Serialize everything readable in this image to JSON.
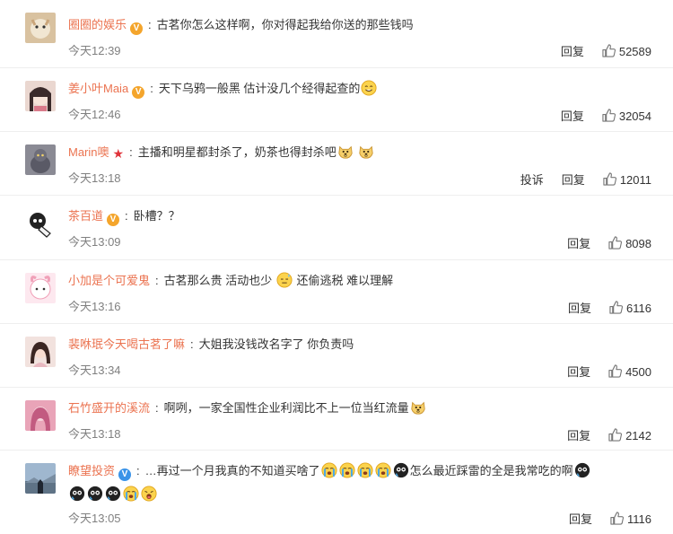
{
  "comments": [
    {
      "user": "圈圈的娱乐",
      "badge": "gold",
      "text": "古茗你怎么这样啊，你对得起我给你送的那些钱吗",
      "time": "今天12:39",
      "reply": "回复",
      "likes": "52589",
      "emojis": []
    },
    {
      "user": "姜小叶Maia",
      "badge": "gold",
      "text": "天下乌鸦一般黑 估计没几个经得起查的",
      "time": "今天12:46",
      "reply": "回复",
      "likes": "32054",
      "emojis": [
        "smile"
      ]
    },
    {
      "user": "Marin噢",
      "badge": "star",
      "text": "主播和明星都封杀了，奶茶也得封杀吧",
      "time": "今天13:18",
      "report": "投诉",
      "reply": "回复",
      "likes": "12011",
      "emojis": [
        "doge",
        "doge"
      ]
    },
    {
      "user": "茶百道",
      "badge": "gold",
      "text": "卧槽？？",
      "time": "今天13:09",
      "reply": "回复",
      "likes": "8098",
      "emojis": []
    },
    {
      "user": "小加是个可爱鬼",
      "badge": "",
      "text": "古茗那么贵 活动也少",
      "text2": "还偷逃税 难以理解",
      "time": "今天13:16",
      "reply": "回复",
      "likes": "6116",
      "emojis": [
        "sweat"
      ]
    },
    {
      "user": "裴咻珉今天喝古茗了嘛",
      "badge": "",
      "text": "大姐我没钱改名字了 你负责吗",
      "time": "今天13:34",
      "reply": "回复",
      "likes": "4500",
      "emojis": []
    },
    {
      "user": "石竹盛开的溪流",
      "badge": "",
      "text": "啊咧，一家全国性企业利润比不上一位当红流量",
      "time": "今天13:18",
      "reply": "回复",
      "likes": "2142",
      "emojis": [
        "doge"
      ]
    },
    {
      "user": "瞭望投资",
      "badge": "blue",
      "text": "…再过一个月我真的不知道买啥了",
      "text2": "怎么最近踩雷的全是我常吃的啊",
      "time": "今天13:05",
      "reply": "回复",
      "likes": "1116",
      "emojis": [
        "cry",
        "cry",
        "cry",
        "cry",
        "black"
      ],
      "emojis_line2": [
        "black",
        "black",
        "black",
        "cry",
        "shock"
      ]
    }
  ]
}
